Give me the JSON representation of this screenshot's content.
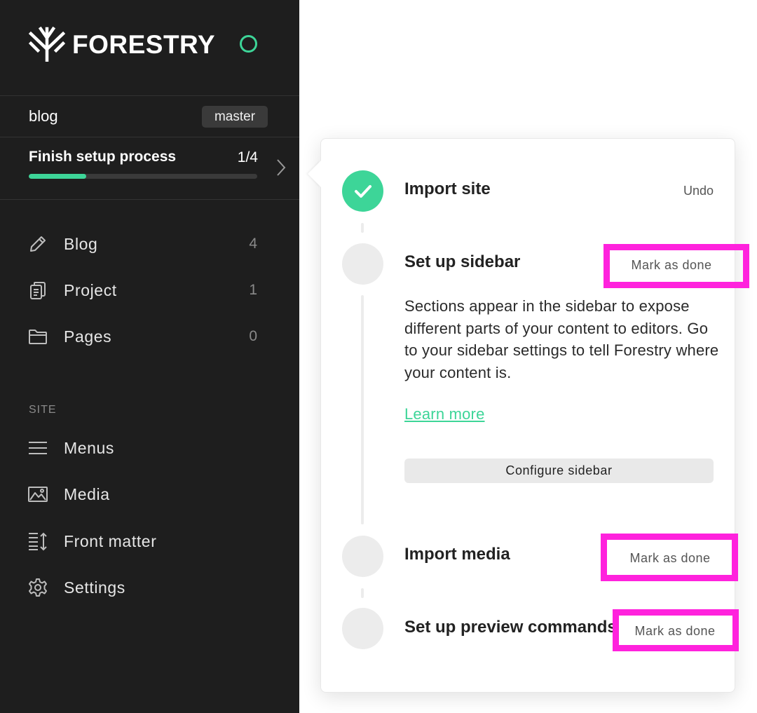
{
  "brand": {
    "name": "FORESTRY",
    "status_color": "#3dd598"
  },
  "repo": {
    "name": "blog",
    "branch": "master"
  },
  "setup": {
    "title": "Finish setup process",
    "count": "1/4",
    "progress": 0.25
  },
  "content_nav": [
    {
      "label": "Blog",
      "count": "4",
      "icon": "pencil-icon"
    },
    {
      "label": "Project",
      "count": "1",
      "icon": "documents-icon"
    },
    {
      "label": "Pages",
      "count": "0",
      "icon": "folder-icon"
    }
  ],
  "site_section": {
    "label": "SITE",
    "items": [
      {
        "label": "Menus",
        "icon": "menu-icon"
      },
      {
        "label": "Media",
        "icon": "image-icon"
      },
      {
        "label": "Front matter",
        "icon": "front-matter-icon"
      },
      {
        "label": "Settings",
        "icon": "gear-icon"
      }
    ]
  },
  "checklist": {
    "steps": [
      {
        "title": "Import site",
        "status": "done",
        "action": "Undo"
      },
      {
        "title": "Set up sidebar",
        "status": "todo",
        "action": "Mark as done",
        "description": "Sections appear in the sidebar to expose different parts of your content to editors. Go to your sidebar settings to tell Forestry where your content is.",
        "learn_more": "Learn more",
        "button": "Configure sidebar"
      },
      {
        "title": "Import media",
        "status": "todo",
        "action": "Mark as done"
      },
      {
        "title": "Set up preview commands",
        "status": "todo",
        "action": "Mark as done"
      }
    ]
  },
  "colors": {
    "accent": "#3dd598",
    "highlight": "#ff22dd",
    "sidebar_bg": "#1e1e1e"
  }
}
